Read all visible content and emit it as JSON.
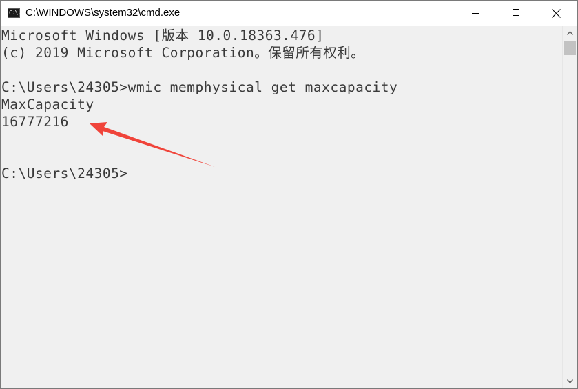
{
  "window": {
    "title": "C:\\WINDOWS\\system32\\cmd.exe",
    "app_icon_text": "C:\\."
  },
  "console": {
    "lines": [
      "Microsoft Windows [版本 10.0.18363.476]",
      "(c) 2019 Microsoft Corporation。保留所有权利。",
      "",
      "C:\\Users\\24305>wmic memphysical get maxcapacity",
      "MaxCapacity",
      "16777216",
      "",
      "",
      "C:\\Users\\24305>"
    ]
  },
  "icons": {
    "minimize": "minimize-icon",
    "maximize": "maximize-icon",
    "close": "close-icon",
    "scroll_up": "chevron-up-icon",
    "scroll_down": "chevron-down-icon"
  },
  "colors": {
    "console_background": "#f0f0f0",
    "console_text": "#3a3a3a",
    "annotation_arrow": "#f0443a"
  }
}
